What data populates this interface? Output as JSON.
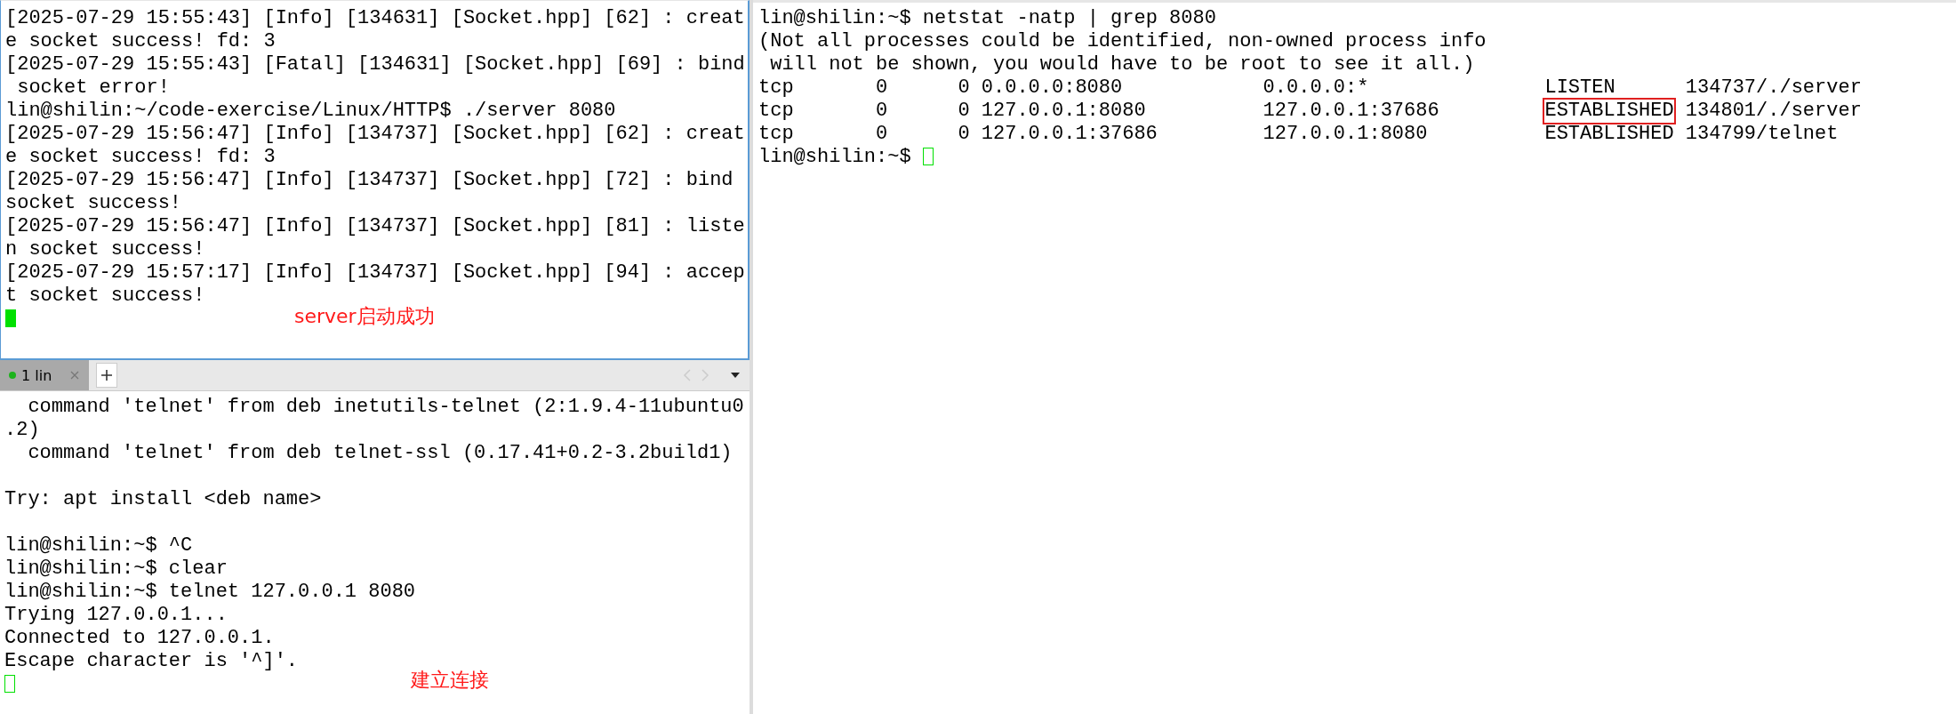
{
  "top_terminal": {
    "focused": true,
    "lines": [
      "[2025-07-29 15:55:43] [Info] [134631] [Socket.hpp] [62] : creat",
      "e socket success! fd: 3",
      "[2025-07-29 15:55:43] [Fatal] [134631] [Socket.hpp] [69] : bind",
      " socket error!",
      "lin@shilin:~/code-exercise/Linux/HTTP$ ./server 8080",
      "[2025-07-29 15:56:47] [Info] [134737] [Socket.hpp] [62] : creat",
      "e socket success! fd: 3",
      "[2025-07-29 15:56:47] [Info] [134737] [Socket.hpp] [72] : bind",
      "socket success!",
      "[2025-07-29 15:56:47] [Info] [134737] [Socket.hpp] [81] : liste",
      "n socket success!",
      "[2025-07-29 15:57:17] [Info] [134737] [Socket.hpp] [94] : accep",
      "t socket success!"
    ],
    "cursor": {
      "filled": true
    },
    "annotation": "server启动成功"
  },
  "tab_bar": {
    "tabs": [
      {
        "label": "1 lin",
        "selected": true
      }
    ]
  },
  "bottom_terminal": {
    "blocks": [
      [
        "  command 'telnet' from deb inetutils-telnet (2:1.9.4-11ubuntu0",
        ".2)",
        "  command 'telnet' from deb telnet-ssl (0.17.41+0.2-3.2build1)"
      ],
      [
        "Try: apt install <deb name>"
      ],
      [
        "lin@shilin:~$ ^C",
        "lin@shilin:~$ clear",
        "lin@shilin:~$ telnet 127.0.0.1 8080",
        "Trying 127.0.0.1...",
        "Connected to 127.0.0.1.",
        "Escape character is '^]'."
      ]
    ],
    "cursor": {
      "filled": false
    },
    "annotation": "建立连接"
  },
  "right_terminal": {
    "lines_before": [
      "lin@shilin:~$ netstat -natp | grep 8080",
      "(Not all processes could be identified, non-owned process info",
      " will not be shown, you would have to be root to see it all.)"
    ],
    "connections": [
      {
        "proto": "tcp",
        "recv_q": "0",
        "send_q": "0",
        "local": "0.0.0.0:8080",
        "foreign": "0.0.0.0:*",
        "state": "LISTEN",
        "program": "134737/./server",
        "highlighted": false
      },
      {
        "proto": "tcp",
        "recv_q": "0",
        "send_q": "0",
        "local": "127.0.0.1:8080",
        "foreign": "127.0.0.1:37686",
        "state": "ESTABLISHED",
        "program": "134801/./server",
        "highlighted": true
      },
      {
        "proto": "tcp",
        "recv_q": "0",
        "send_q": "0",
        "local": "127.0.0.1:37686",
        "foreign": "127.0.0.1:8080",
        "state": "ESTABLISHED",
        "program": "134799/telnet",
        "highlighted": false
      }
    ],
    "prompt": "lin@shilin:~$",
    "cursor": {
      "filled": false
    }
  }
}
